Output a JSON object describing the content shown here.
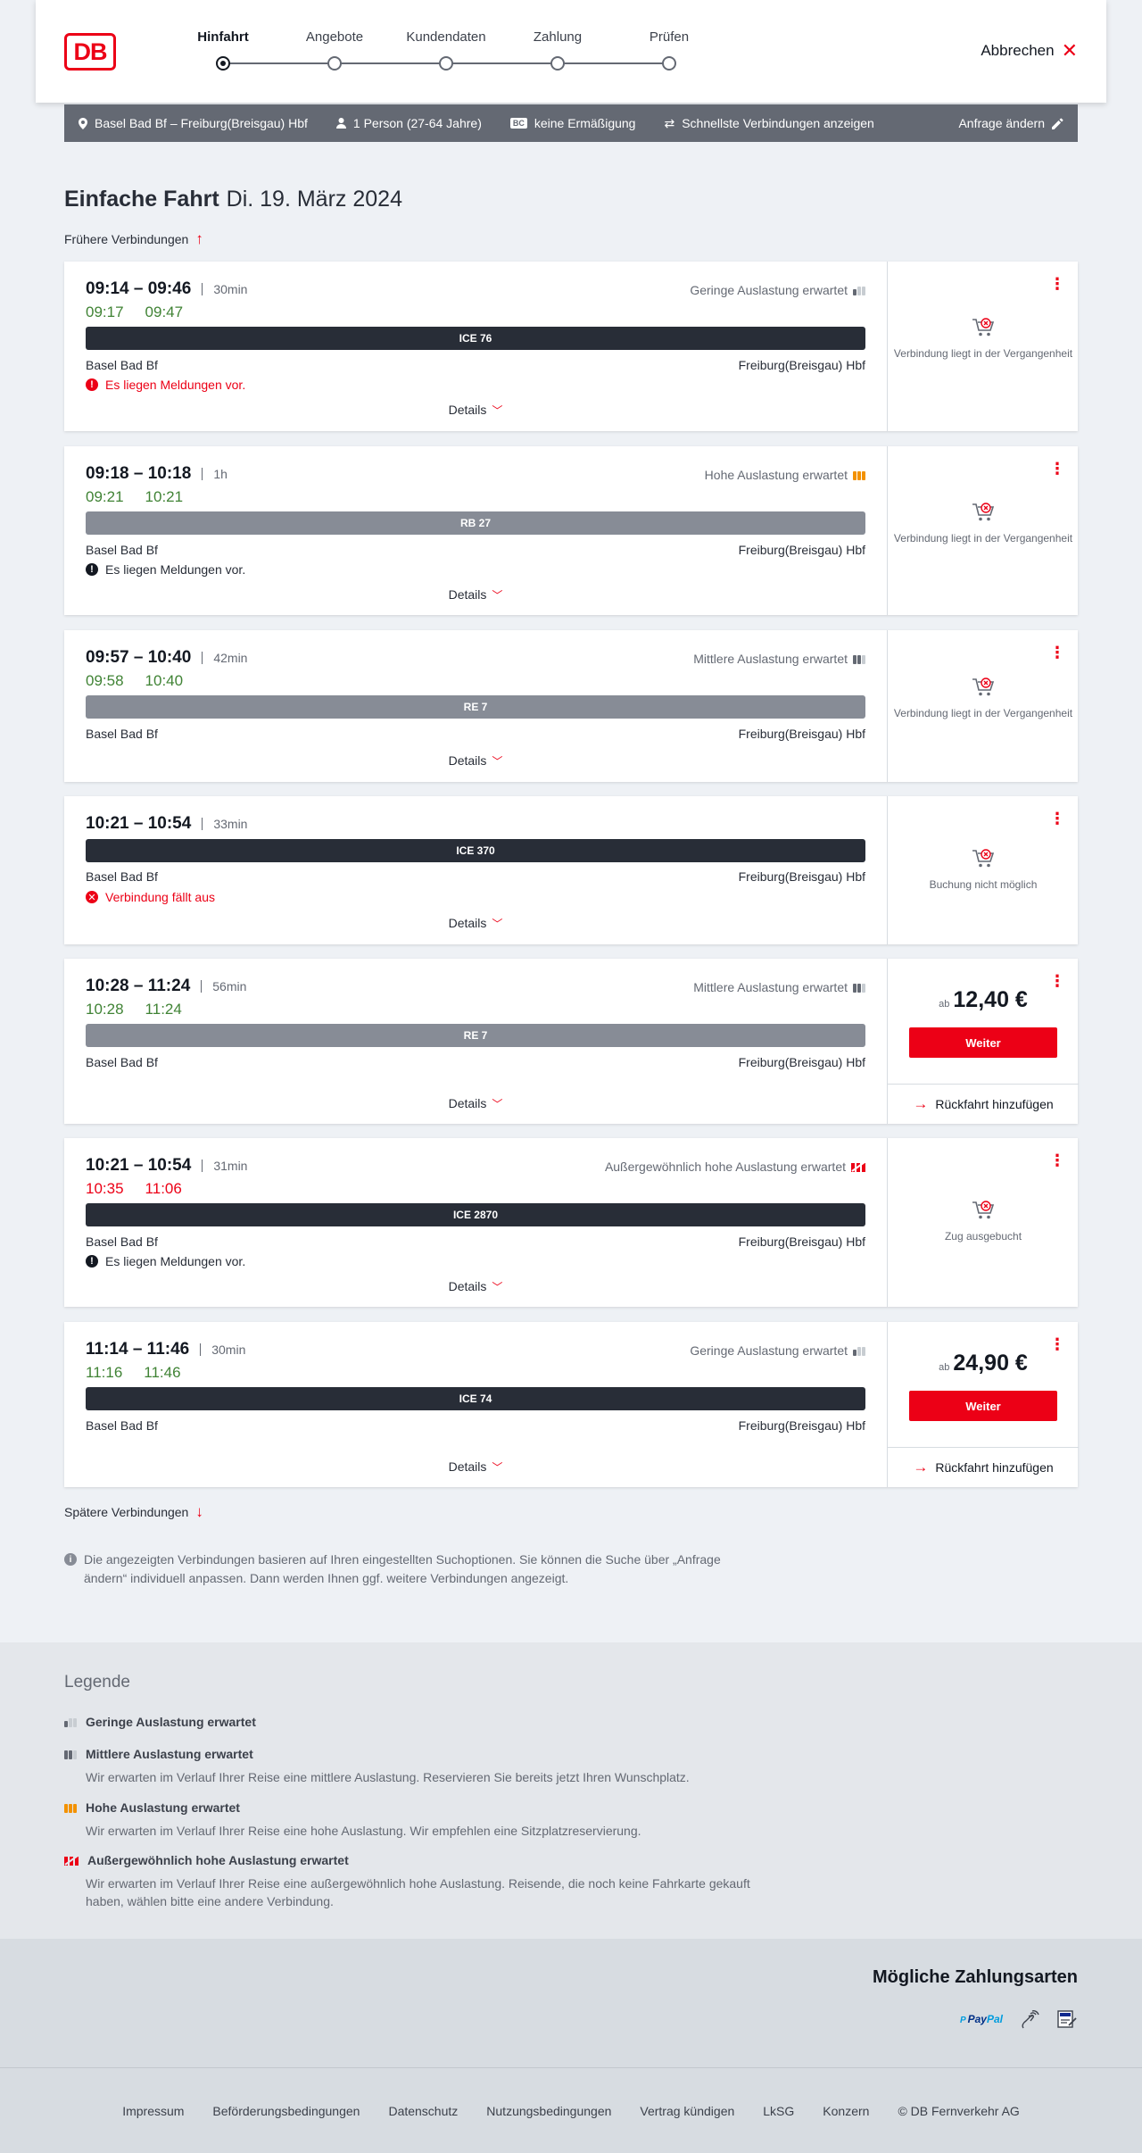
{
  "header": {
    "logo_text": "DB",
    "steps": [
      "Hinfahrt",
      "Angebote",
      "Kundendaten",
      "Zahlung",
      "Prüfen"
    ],
    "cancel_label": "Abbrechen"
  },
  "summary": {
    "route": "Basel Bad Bf – Freiburg(Breisgau) Hbf",
    "passengers": "1 Person (27-64 Jahre)",
    "discount_badge": "BC",
    "discount": "keine Ermäßigung",
    "option": "Schnellste Verbindungen anzeigen",
    "edit_label": "Anfrage ändern"
  },
  "title": {
    "type": "Einfache Fahrt",
    "date": "Di. 19. März 2024"
  },
  "earlier_label": "Frühere Verbindungen",
  "later_label": "Spätere Verbindungen",
  "details_label": "Details",
  "connections": [
    {
      "time": "09:14 – 09:46",
      "duration": "30min",
      "rt_dep": "09:17",
      "rt_arr": "09:47",
      "load": "Geringe Auslastung erwartet",
      "train": "ICE 76",
      "from": "Basel Bad Bf",
      "to": "Freiburg(Breisgau) Hbf",
      "message": "Es liegen Meldungen vor.",
      "status": "Verbindung liegt in der Vergangenheit"
    },
    {
      "time": "09:18 – 10:18",
      "duration": "1h",
      "rt_dep": "09:21",
      "rt_arr": "10:21",
      "load": "Hohe Auslastung erwartet",
      "train": "RB 27",
      "from": "Basel Bad Bf",
      "to": "Freiburg(Breisgau) Hbf",
      "message": "Es liegen Meldungen vor.",
      "status": "Verbindung liegt in der Vergangenheit"
    },
    {
      "time": "09:57 – 10:40",
      "duration": "42min",
      "rt_dep": "09:58",
      "rt_arr": "10:40",
      "load": "Mittlere Auslastung erwartet",
      "train": "RE 7",
      "from": "Basel Bad Bf",
      "to": "Freiburg(Breisgau) Hbf",
      "status": "Verbindung liegt in der Vergangenheit"
    },
    {
      "time": "10:21 – 10:54",
      "duration": "33min",
      "train": "ICE 370",
      "from": "Basel Bad Bf",
      "to": "Freiburg(Breisgau) Hbf",
      "message": "Verbindung fällt aus",
      "status": "Buchung nicht möglich"
    },
    {
      "time": "10:28 – 11:24",
      "duration": "56min",
      "rt_dep": "10:28",
      "rt_arr": "11:24",
      "load": "Mittlere Auslastung erwartet",
      "train": "RE 7",
      "from": "Basel Bad Bf",
      "to": "Freiburg(Breisgau) Hbf",
      "price_prefix": "ab",
      "price": "12,40 €",
      "button": "Weiter",
      "return_label": "Rückfahrt hinzufügen"
    },
    {
      "time": "10:21 – 10:54",
      "duration": "31min",
      "rt_dep": "10:35",
      "rt_arr": "11:06",
      "load": "Außergewöhnlich hohe Auslastung erwartet",
      "train": "ICE 2870",
      "from": "Basel Bad Bf",
      "to": "Freiburg(Breisgau) Hbf",
      "message": "Es liegen Meldungen vor.",
      "status": "Zug ausgebucht"
    },
    {
      "time": "11:14 – 11:46",
      "duration": "30min",
      "rt_dep": "11:16",
      "rt_arr": "11:46",
      "load": "Geringe Auslastung erwartet",
      "train": "ICE 74",
      "from": "Basel Bad Bf",
      "to": "Freiburg(Breisgau) Hbf",
      "price_prefix": "ab",
      "price": "24,90 €",
      "button": "Weiter",
      "return_label": "Rückfahrt hinzufügen"
    }
  ],
  "info_text": "Die angezeigten Verbindungen basieren auf Ihren eingestellten Suchoptionen. Sie können die Suche über „Anfrage ändern“ individuell anpassen. Dann werden Ihnen ggf. weitere Verbindungen angezeigt.",
  "legend": {
    "title": "Legende",
    "items": [
      {
        "label": "Geringe Auslastung erwartet",
        "text": ""
      },
      {
        "label": "Mittlere Auslastung erwartet",
        "text": "Wir erwarten im Verlauf Ihrer Reise eine mittlere Auslastung. Reservieren Sie bereits jetzt Ihren Wunschplatz."
      },
      {
        "label": "Hohe Auslastung erwartet",
        "text": "Wir erwarten im Verlauf Ihrer Reise eine hohe Auslastung. Wir empfehlen eine Sitzplatzreservierung."
      },
      {
        "label": "Außergewöhnlich hohe Auslastung erwartet",
        "text": "Wir erwarten im Verlauf Ihrer Reise eine außergewöhnlich hohe Auslastung. Reisende, die noch keine Fahrkarte gekauft haben, wählen bitte eine andere Verbindung."
      }
    ]
  },
  "payment": {
    "title": "Mögliche Zahlungsarten",
    "paypal_a": "Pay",
    "paypal_b": "Pal",
    "sepa": "SEPA"
  },
  "footer": [
    "Impressum",
    "Beförderungsbedingungen",
    "Datenschutz",
    "Nutzungsbedingungen",
    "Vertrag kündigen",
    "LkSG",
    "Konzern",
    "© DB Fernverkehr AG"
  ],
  "colors": {
    "accent": "#ec0016",
    "on_time": "#408335",
    "dark": "#282d37",
    "regional_train": "#878c96",
    "high_load": "#f39200"
  }
}
